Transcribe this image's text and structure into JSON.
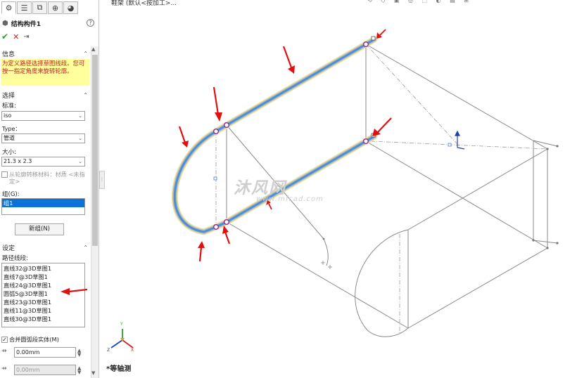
{
  "breadcrumb": "鞋架 (默认<按加工>...",
  "pm": {
    "title": "结构构件1",
    "help": "?",
    "info_title": "信息",
    "info_text": "为定义路径选择草图线段。您可按一指定角度来旋转轮廓。",
    "selection_title": "选择",
    "standard_label": "标准:",
    "standard_value": "iso",
    "type_label": "Type：",
    "type_value": "管道",
    "size_label": "大小:",
    "size_value": "21.3 x 2.3",
    "transfer_material_label": "从轮廓转移材料：材质 <未指定>",
    "group_label": "组(G):",
    "groups": [
      "组1"
    ],
    "new_group_button": "新组(N)",
    "settings_title": "设定",
    "path_segments_label": "路径线段:",
    "path_segments": [
      "直线32@3D草图1",
      "直线7@3D草图1",
      "直线24@3D草图1",
      "圆弧5@3D草图1",
      "直线23@3D草图1",
      "直线11@3D草图1",
      "直线30@3D草图1"
    ],
    "merge_arc_label": "合并圆弧段实体(M)",
    "offset_1": "0.00mm",
    "offset_2": "0.00mm"
  },
  "viewport": {
    "view_name": "*等轴测",
    "watermark_cn": "沐风网",
    "watermark_url": "www.mfcad.com",
    "triad_y": "Y",
    "triad_x": "X",
    "triad_z": "Z"
  },
  "colors": {
    "selection_blue": "#0a72d8",
    "info_yellow": "#ffff9c",
    "info_red": "#c02020",
    "path_highlight": "#4a90d9",
    "arrow_red": "#e01010"
  }
}
